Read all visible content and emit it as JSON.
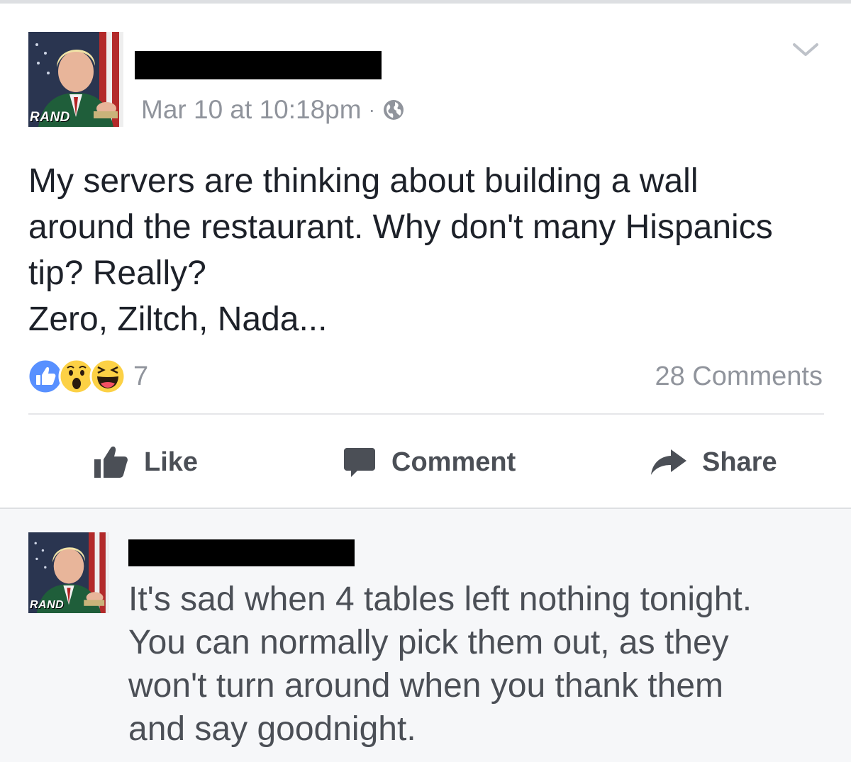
{
  "post": {
    "author_avatar_badge": "RAND",
    "timestamp": "Mar 10 at 10:18pm",
    "separator": "·",
    "privacy_icon": "globe-icon",
    "menu_icon": "chevron-down-icon",
    "text_lines": [
      "My servers are thinking about building a wall",
      "around the restaurant. Why don't many Hispanics",
      "tip? Really?",
      "Zero, Ziltch, Nada..."
    ],
    "reactions": {
      "icons": [
        "like-reaction-icon",
        "wow-reaction-icon",
        "haha-reaction-icon"
      ],
      "count": "7"
    },
    "comments_count": "28 Comments",
    "actions": {
      "like_label": "Like",
      "comment_label": "Comment",
      "share_label": "Share"
    }
  },
  "comment": {
    "author_avatar_badge": "RAND",
    "text_lines": [
      "It's sad when 4 tables left nothing tonight.",
      "You can normally pick them out, as they",
      "won't turn around when you thank them",
      "and say goodnight."
    ]
  },
  "colors": {
    "like_blue": "#5890ff",
    "emoji_yellow": "#fcd145",
    "muted_text": "#90949c",
    "action_text": "#4b4f56",
    "comment_bg": "#f6f7f9"
  }
}
